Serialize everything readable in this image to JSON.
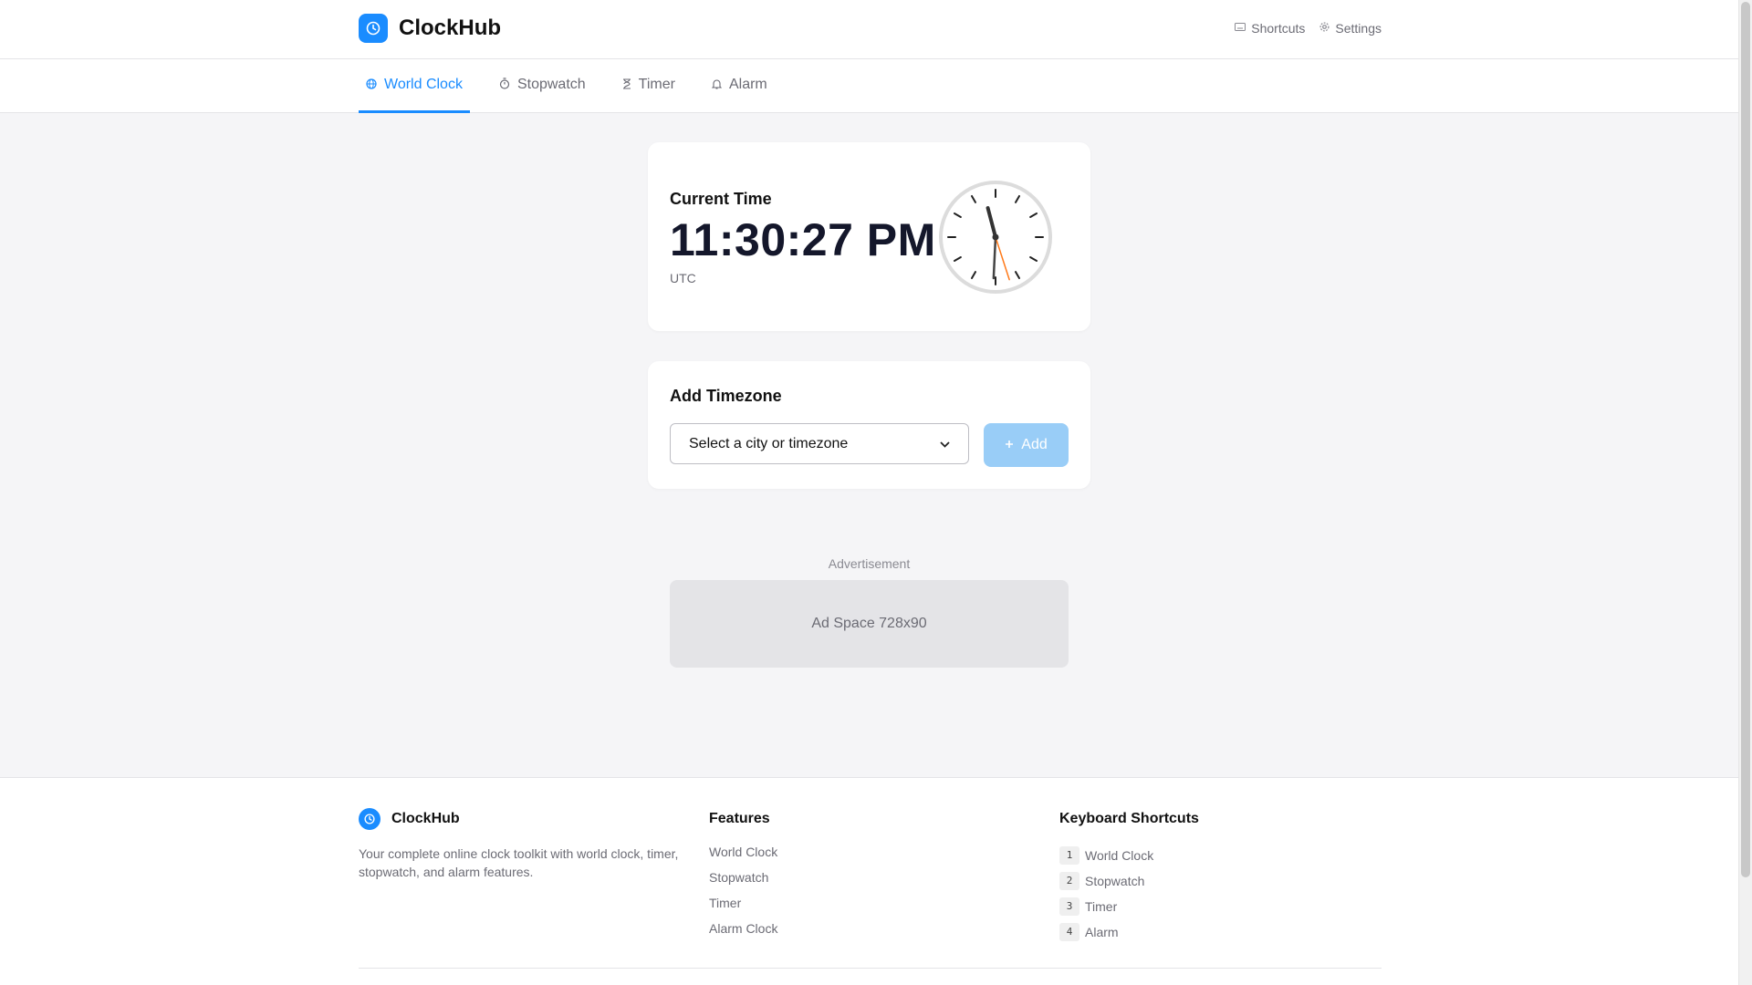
{
  "brand": {
    "name": "ClockHub",
    "logo_icon": "clock-icon",
    "accent": "#1a8cff"
  },
  "header_links": [
    {
      "label": "Shortcuts",
      "icon": "keyboard-icon"
    },
    {
      "label": "Settings",
      "icon": "gear-icon"
    }
  ],
  "tabs": [
    {
      "label": "World Clock",
      "icon": "globe-icon",
      "active": true
    },
    {
      "label": "Stopwatch",
      "icon": "stopwatch-icon",
      "active": false
    },
    {
      "label": "Timer",
      "icon": "hourglass-icon",
      "active": false
    },
    {
      "label": "Alarm",
      "icon": "bell-icon",
      "active": false
    }
  ],
  "current_time": {
    "label": "Current Time",
    "time": "11:30:27 PM",
    "zone": "UTC",
    "analog": {
      "hours": 23,
      "minutes": 30,
      "seconds": 27
    }
  },
  "add_timezone": {
    "title": "Add Timezone",
    "select_value": "Select a city or timezone",
    "add_label": "Add",
    "add_icon": "plus-icon"
  },
  "ad": {
    "label": "Advertisement",
    "placeholder": "Ad Space 728x90"
  },
  "footer": {
    "brand_name": "ClockHub",
    "description": "Your complete online clock toolkit with world clock, timer, stopwatch, and alarm features.",
    "features_title": "Features",
    "features": [
      "World Clock",
      "Stopwatch",
      "Timer",
      "Alarm Clock"
    ],
    "shortcuts_title": "Keyboard Shortcuts",
    "shortcuts": [
      {
        "key": "1",
        "label": "World Clock"
      },
      {
        "key": "2",
        "label": "Stopwatch"
      },
      {
        "key": "3",
        "label": "Timer"
      },
      {
        "key": "4",
        "label": "Alarm"
      }
    ]
  }
}
